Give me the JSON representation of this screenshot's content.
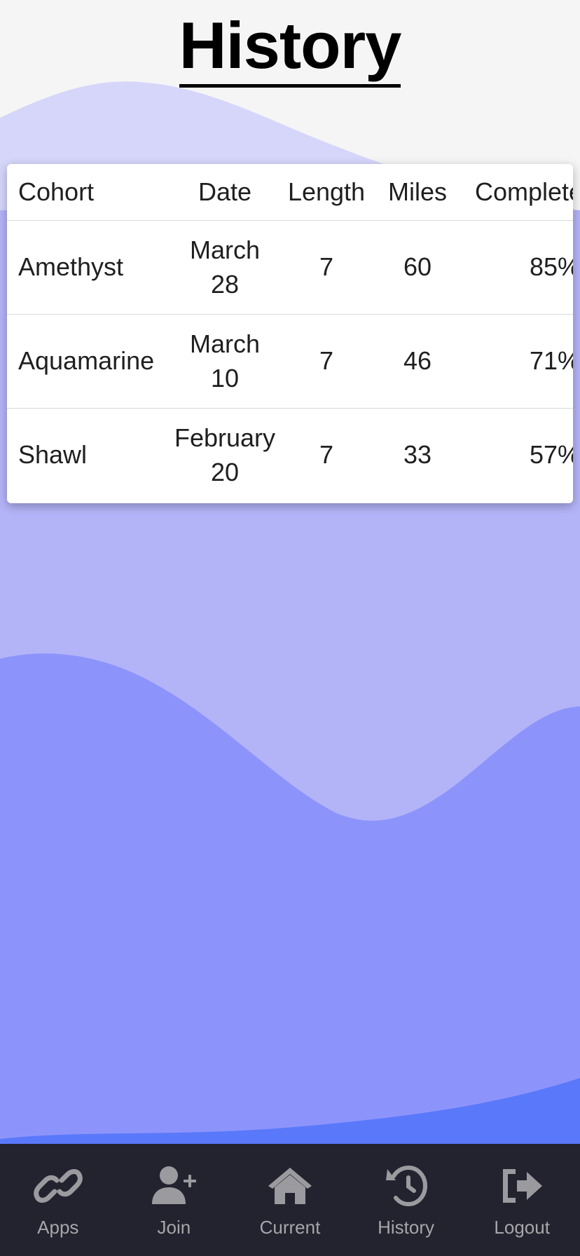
{
  "page": {
    "title": "History"
  },
  "table": {
    "headers": {
      "cohort": "Cohort",
      "date": "Date",
      "length": "Length",
      "miles": "Miles",
      "complete": "Complete"
    },
    "rows": [
      {
        "cohort": "Amethyst",
        "date": "March 28",
        "length": "7",
        "miles": "60",
        "complete": "85%"
      },
      {
        "cohort": "Aquamarine",
        "date": "March 10",
        "length": "7",
        "miles": "46",
        "complete": "71%"
      },
      {
        "cohort": "Shawl",
        "date": "February 20",
        "length": "7",
        "miles": "33",
        "complete": "57%"
      }
    ]
  },
  "tabbar": {
    "items": [
      {
        "label": "Apps",
        "icon": "link-icon"
      },
      {
        "label": "Join",
        "icon": "user-plus-icon"
      },
      {
        "label": "Current",
        "icon": "home-icon"
      },
      {
        "label": "History",
        "icon": "history-icon"
      },
      {
        "label": "Logout",
        "icon": "logout-icon"
      }
    ]
  },
  "colors": {
    "background": "#f5f5f5",
    "wave_light": "#d6d6fa",
    "wave_mid": "#b3b3f8",
    "wave_deep": "#8c94fb",
    "wave_bottom": "#5a78fa",
    "tabbar": "#232330",
    "tab_text": "#a6a6aa"
  }
}
